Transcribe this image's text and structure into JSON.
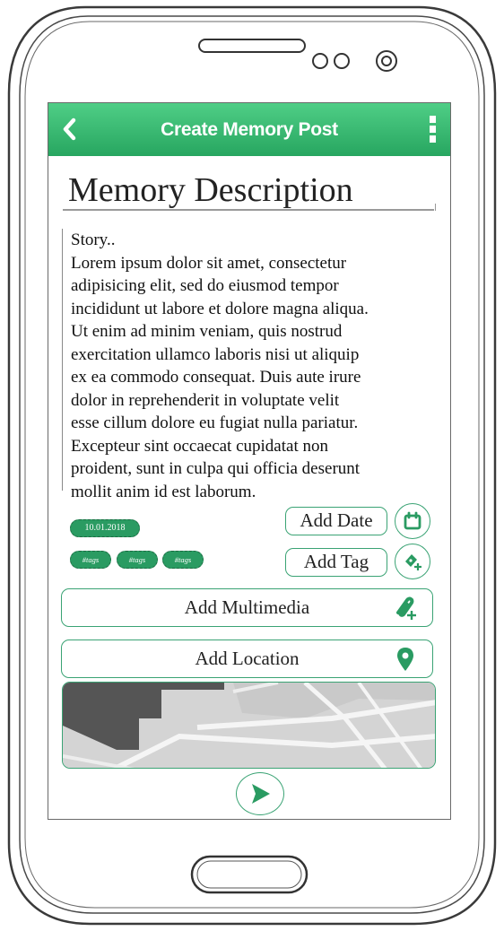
{
  "app_bar": {
    "title": "Create Memory Post",
    "back_icon": "chevron-left-icon",
    "menu_icon": "vertical-dots-icon",
    "color_top": "#4fce86",
    "color_bottom": "#27a660"
  },
  "form": {
    "title_value": "Memory Description",
    "story_lines": [
      "Story..",
      "Lorem ipsum dolor sit amet, consectetur",
      "adipisicing elit, sed do eiusmod tempor",
      "incididunt ut labore et dolore magna aliqua.",
      "Ut enim ad minim veniam, quis nostrud",
      "exercitation ullamco laboris nisi ut aliquip",
      "ex ea commodo consequat. Duis aute irure",
      "dolor in reprehenderit in voluptate velit",
      "esse cillum dolore eu fugiat nulla pariatur.",
      "Excepteur sint occaecat cupidatat non",
      "proident, sunt in culpa qui officia deserunt",
      "mollit anim id est laborum."
    ],
    "date_chip": "10.01.2018",
    "tag_chips": [
      "#tags",
      "#tags",
      "#tags"
    ],
    "add_date_label": "Add Date",
    "add_tag_label": "Add Tag",
    "add_multimedia_label": "Add Multimedia",
    "add_location_label": "Add Location"
  },
  "icons": {
    "calendar": "calendar-icon",
    "add_tag": "tag-add-icon",
    "multimedia": "paperclip-add-icon",
    "location": "map-pin-icon",
    "send": "send-icon"
  },
  "colors": {
    "accent": "#2a9b62",
    "outline": "#3aa374"
  }
}
